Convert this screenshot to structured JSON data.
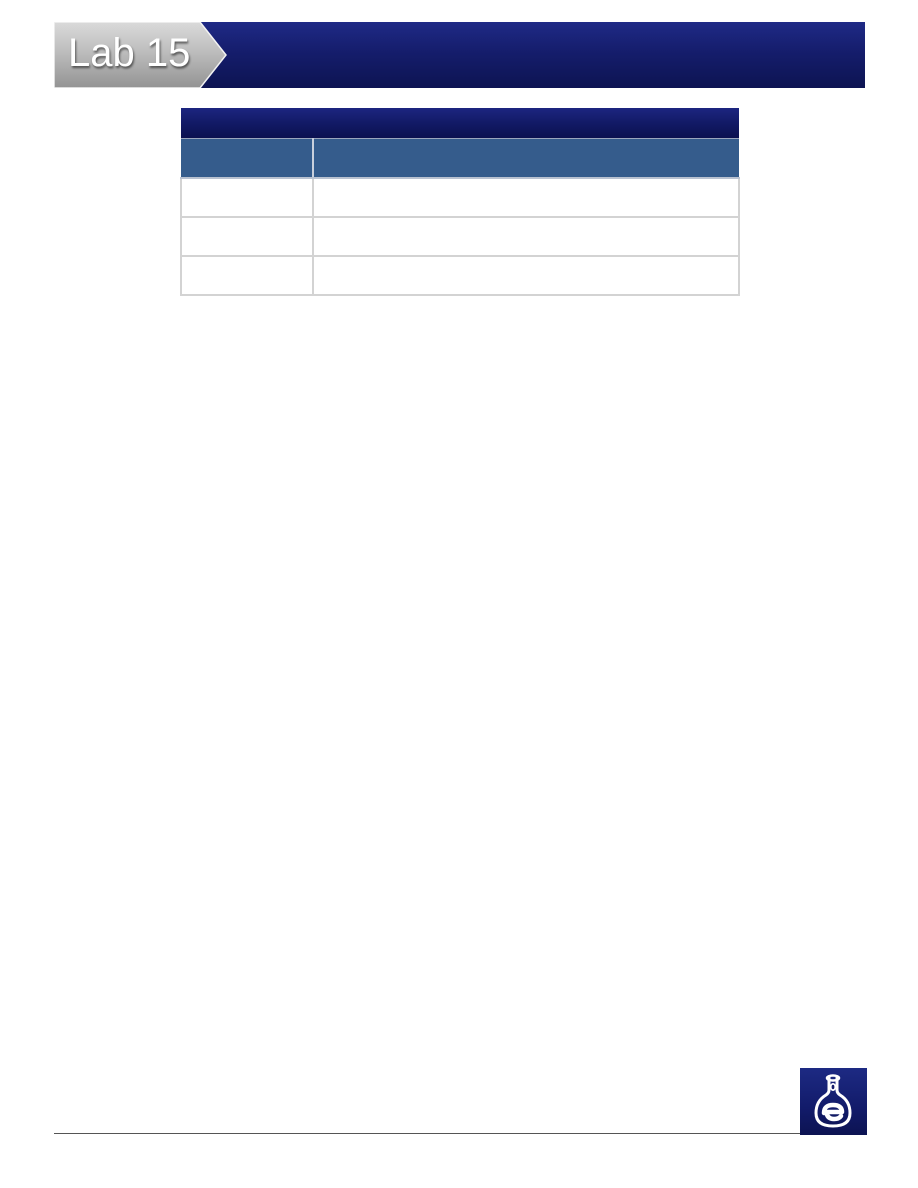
{
  "header": {
    "lab_title": "Lab 15"
  },
  "table": {
    "title": "",
    "columns": [
      "",
      ""
    ],
    "rows": [
      [
        "",
        ""
      ],
      [
        "",
        ""
      ],
      [
        "",
        ""
      ]
    ]
  },
  "colors": {
    "banner_navy": "#151d6c",
    "tab_gray": "#bcbcbc",
    "table_header_blue": "#355c8c",
    "border_gray": "#d3d3d3"
  },
  "icons": {
    "logo": "flask-e-logo-icon"
  }
}
